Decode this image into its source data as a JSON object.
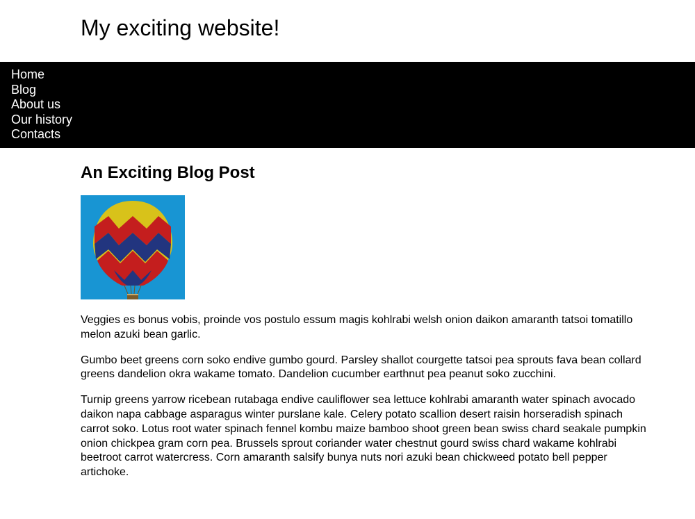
{
  "header": {
    "site_title": "My exciting website!"
  },
  "nav": {
    "items": [
      {
        "label": "Home"
      },
      {
        "label": "Blog"
      },
      {
        "label": "About us"
      },
      {
        "label": "Our history"
      },
      {
        "label": "Contacts"
      }
    ]
  },
  "post": {
    "title": "An Exciting Blog Post",
    "image_alt": "Hot air balloon",
    "paragraphs": [
      "Veggies es bonus vobis, proinde vos postulo essum magis kohlrabi welsh onion daikon amaranth tatsoi tomatillo melon azuki bean garlic.",
      "Gumbo beet greens corn soko endive gumbo gourd. Parsley shallot courgette tatsoi pea sprouts fava bean collard greens dandelion okra wakame tomato. Dandelion cucumber earthnut pea peanut soko zucchini.",
      "Turnip greens yarrow ricebean rutabaga endive cauliflower sea lettuce kohlrabi amaranth water spinach avocado daikon napa cabbage asparagus winter purslane kale. Celery potato scallion desert raisin horseradish spinach carrot soko. Lotus root water spinach fennel kombu maize bamboo shoot green bean swiss chard seakale pumpkin onion chickpea gram corn pea. Brussels sprout coriander water chestnut gourd swiss chard wakame kohlrabi beetroot carrot watercress. Corn amaranth salsify bunya nuts nori azuki bean chickweed potato bell pepper artichoke."
    ]
  }
}
